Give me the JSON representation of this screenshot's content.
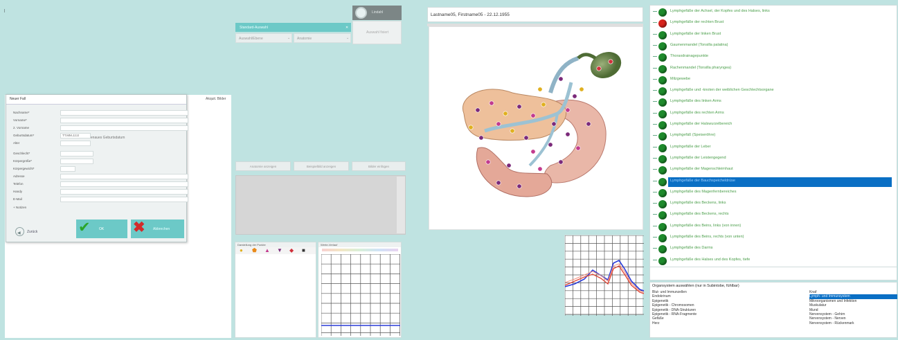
{
  "top_left_marker": "|",
  "header": {
    "logo_label": "Lindahl",
    "right_box_label": "Auswahl fixiert"
  },
  "topbar_mid": {
    "select_main": "Standard-Auswahl",
    "select_a": "Auswahl/Ebene",
    "select_b": "Anatomie"
  },
  "dialog": {
    "title": "Neuer Fall",
    "fields": [
      {
        "label": "Nachname*",
        "value": ""
      },
      {
        "label": "Vorname*",
        "value": ""
      },
      {
        "label": "2. Vorname",
        "value": ""
      },
      {
        "label": "Geburtsdatum*",
        "value": "TT.MM.JJJJ"
      },
      {
        "label": "Alter",
        "value": ""
      },
      {
        "label": "Geschlecht*",
        "value": ""
      },
      {
        "label": "Körpergröße*",
        "value": ""
      },
      {
        "label": "Körpergewicht*",
        "value": ""
      },
      {
        "label": "Adresse",
        "value": ""
      },
      {
        "label": "Telefon",
        "value": ""
      },
      {
        "label": "Handy",
        "value": ""
      },
      {
        "label": "E-Mail",
        "value": ""
      }
    ],
    "dob_hint": "Genaues Geburtsdatum",
    "notes_label": "Notizen",
    "back_label": "Zurück",
    "ok_label": "OK",
    "cancel_label": "Abbrechen"
  },
  "side_label": "Akquit. Bilder",
  "mid_tabs": [
    "Anatomie anzeigen",
    "Beispielbild anzeigen",
    "Bilder einfügen"
  ],
  "markers_panel": {
    "title": "Darstellung der Punkte",
    "colors": [
      "#e0b020",
      "#e98a1a",
      "#c23b8e",
      "#7b2a7a",
      "#d0303a",
      "#333333"
    ]
  },
  "chart_small": {
    "title": "Werte-Verlauf"
  },
  "image_header": "Lastname05, Firstname05 - 22.12.1955",
  "tree": {
    "items": [
      {
        "label": "Lymphgefäße der Achsel, der Kopfes und des Halses, links",
        "status": "green"
      },
      {
        "label": "Lymphgefäße der rechten Brust",
        "status": "red"
      },
      {
        "label": "Lymphgefäße der linken Brust",
        "status": "green"
      },
      {
        "label": "Gaumenmandel (Tonsilla palatina)",
        "status": "green"
      },
      {
        "label": "Thoraxdrainagepunkte",
        "status": "green"
      },
      {
        "label": "Rachenmandel (Tonsilla pharyngea)",
        "status": "green"
      },
      {
        "label": "Milzgewebe",
        "status": "green"
      },
      {
        "label": "Lymphgefäße und -knoten der weiblichen Geschlechtsorgane",
        "status": "green"
      },
      {
        "label": "Lymphgefäße des linken Arms",
        "status": "green"
      },
      {
        "label": "Lymphgefäße des rechten Arms",
        "status": "green"
      },
      {
        "label": "Lymphgefäße der Halswurzelbereich",
        "status": "green"
      },
      {
        "label": "Lymphgefäß (Speiseröhre)",
        "status": "green"
      },
      {
        "label": "Lymphgefäße der Leber",
        "status": "green"
      },
      {
        "label": "Lymphgefäße der Leistengegend",
        "status": "green"
      },
      {
        "label": "Lymphgefäße der Magenschleimhaut",
        "status": "green"
      },
      {
        "label": "Lymphgefäße der Bauchspeicheldrüse",
        "status": "selected"
      },
      {
        "label": "Lymphgefäße des Magenfernbereiches",
        "status": "green"
      },
      {
        "label": "Lymphgefäße des Beckens, links",
        "status": "green"
      },
      {
        "label": "Lymphgefäße des Beckens, rechts",
        "status": "green"
      },
      {
        "label": "Lymphgefäße des Beins, links (von innen)",
        "status": "green"
      },
      {
        "label": "Lymphgefäße des Beins, rechts (von unten)",
        "status": "green"
      },
      {
        "label": "Lymphgefäße des Darms",
        "status": "green"
      },
      {
        "label": "Lymphgefäße des Halses und des Kopfes, tiefe",
        "status": "green"
      }
    ]
  },
  "organ_list": {
    "title": "Organsystem auswählen (nur in Subintobe, fühlbar)",
    "left": [
      "Blut- und Immunzellen",
      "Endokrinum",
      "Epigenetik",
      "Epigenetik - Chromosomen",
      "Epigenetik - DNA-Strukturen",
      "Epigenetik - RNA-Fragmente",
      "Gefäße",
      "Herz"
    ],
    "right": [
      "Knaf",
      "Lymph- und Immunsystem",
      "Mikroorganismen und Infektion",
      "Muskulatur",
      "Mund",
      "Nervensystem - Gehirn",
      "Nervensystem - Nerven",
      "Nervensystem - Rückenmark"
    ],
    "right_selected_index": 1
  },
  "colors": {
    "bg": "#bfe3e1",
    "teal": "#6cc9c7",
    "selected_blue": "#0a6fc4",
    "line_blue": "#2a3bd8",
    "line_red": "#e04a3a"
  }
}
